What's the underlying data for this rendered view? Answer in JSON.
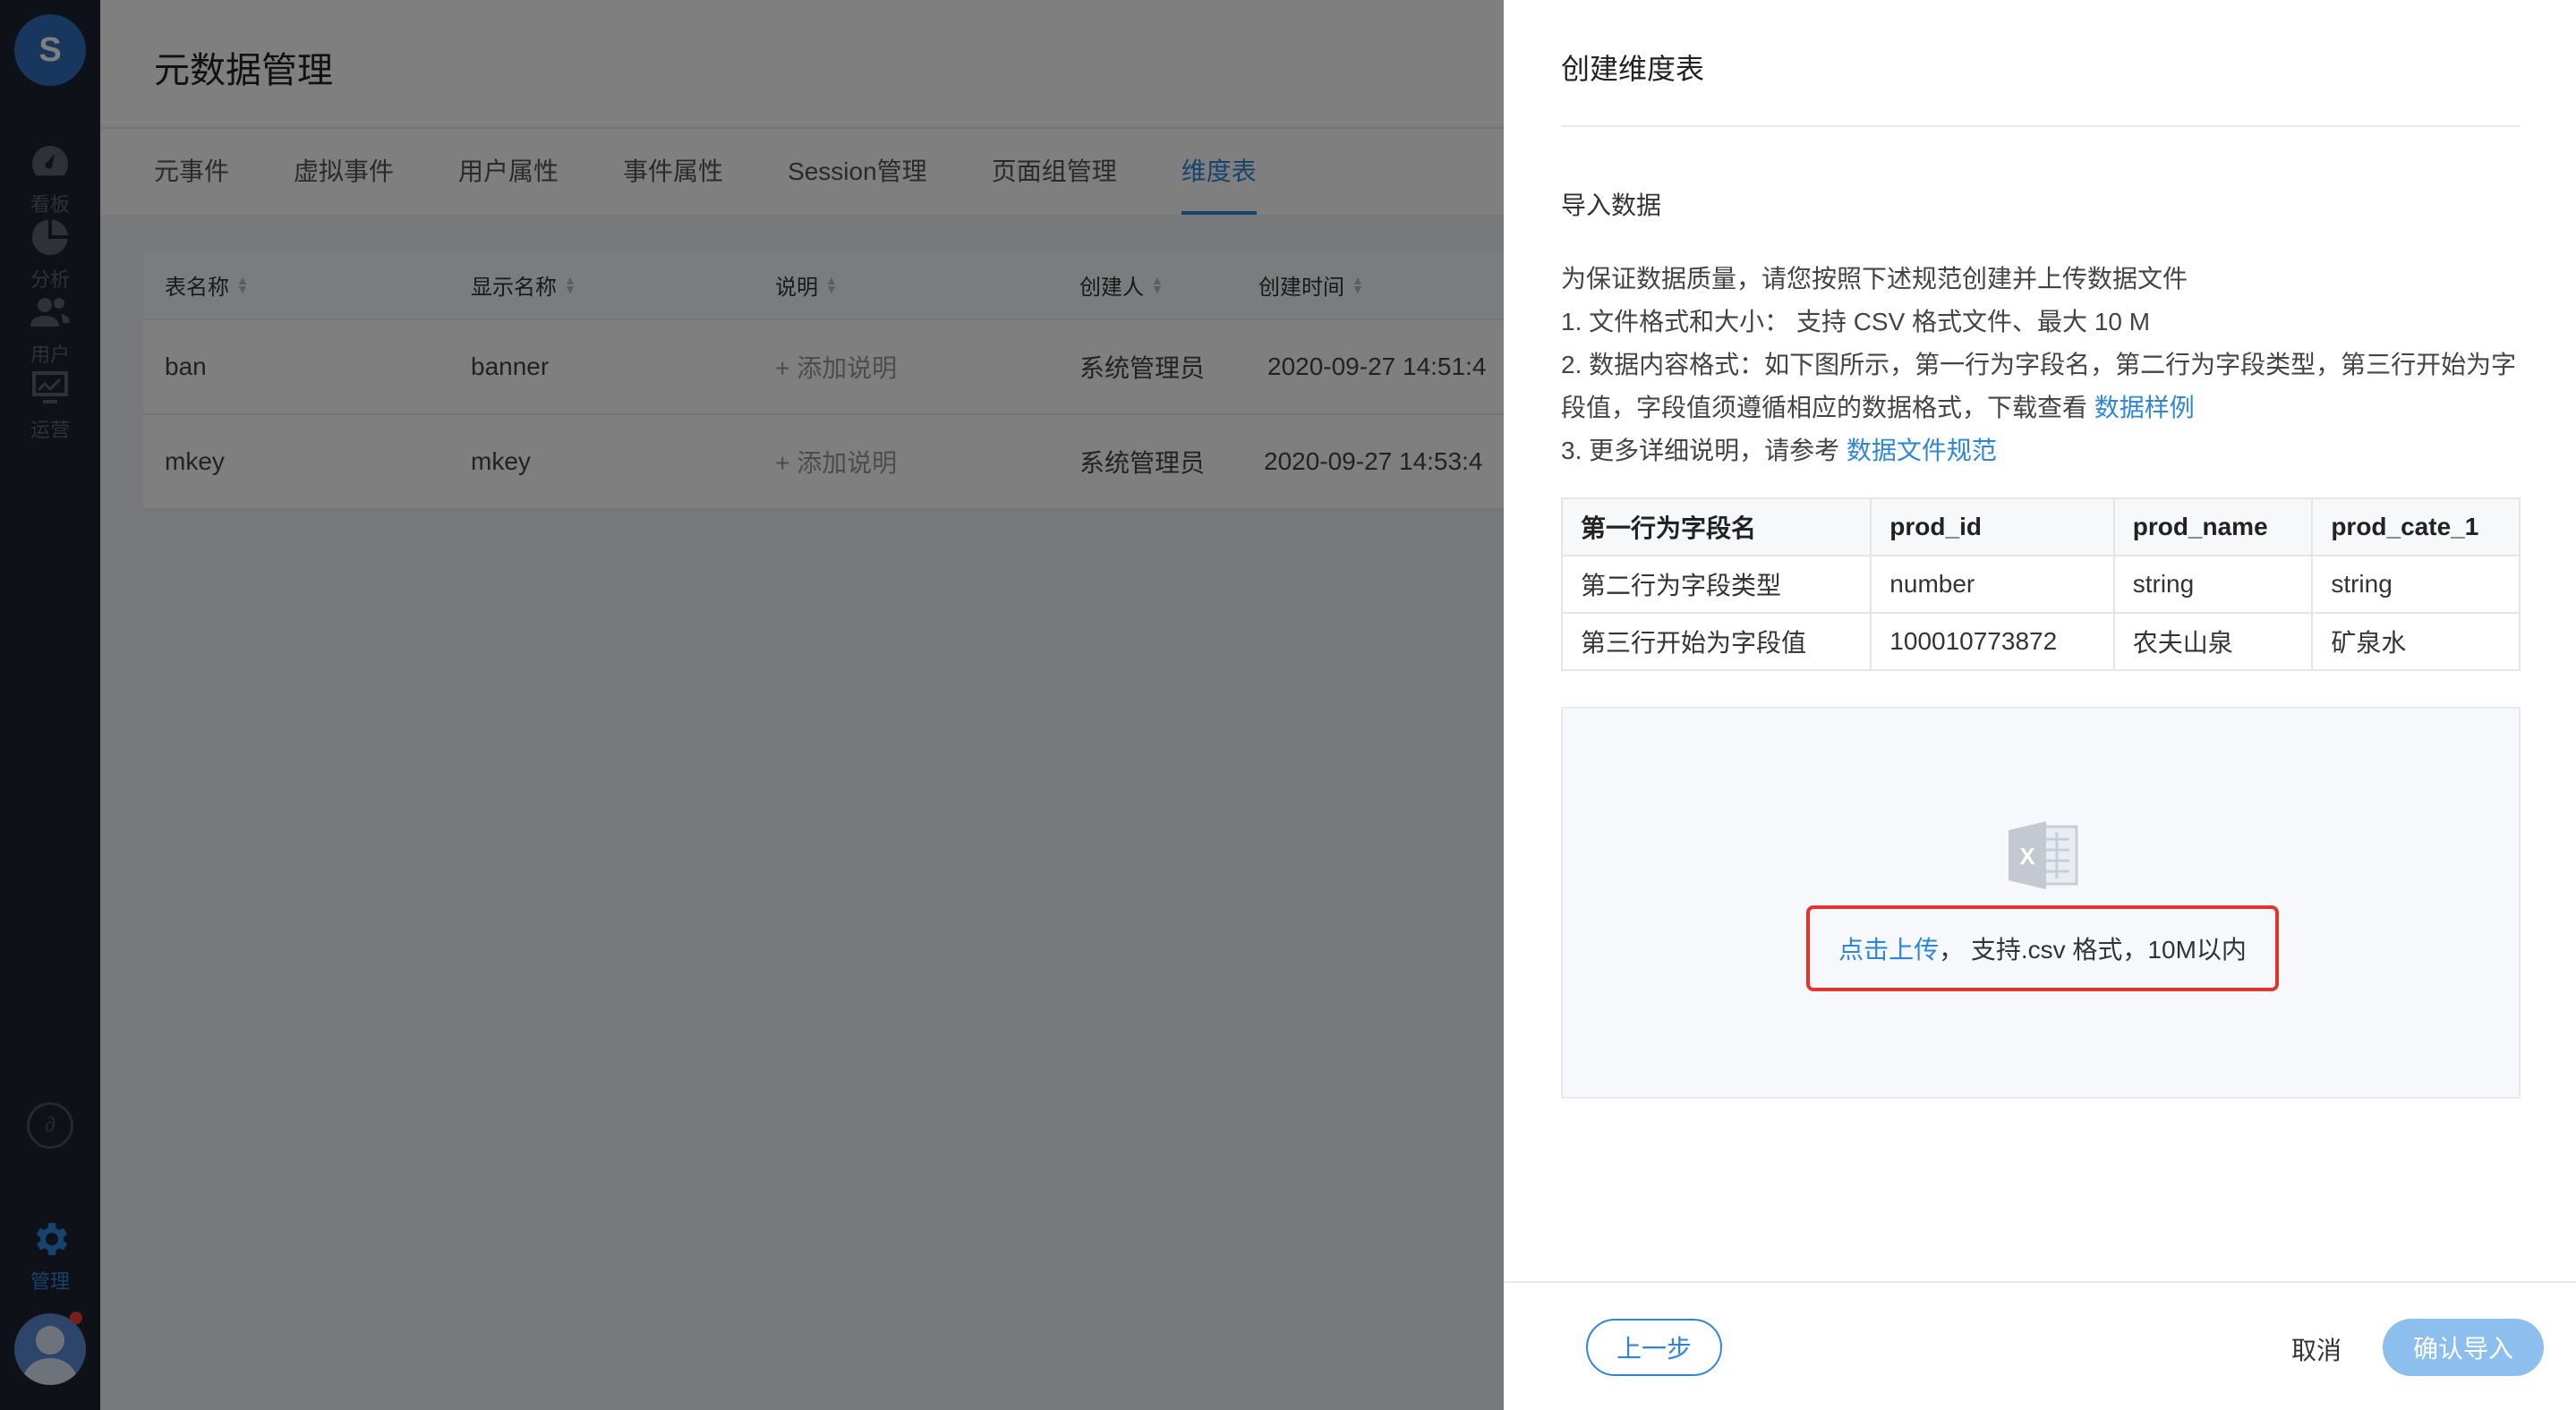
{
  "nav": {
    "logo": "S",
    "items": [
      {
        "label": "看板",
        "icon": "dashboard-icon"
      },
      {
        "label": "分析",
        "icon": "pie-chart-icon"
      },
      {
        "label": "用户",
        "icon": "users-icon"
      },
      {
        "label": "运营",
        "icon": "monitor-chart-icon"
      },
      {
        "label": "管理",
        "icon": "gear-icon"
      }
    ]
  },
  "page": {
    "title": "元数据管理",
    "tabs": [
      "元事件",
      "虚拟事件",
      "用户属性",
      "事件属性",
      "Session管理",
      "页面组管理",
      "维度表"
    ],
    "active_tab": "维度表"
  },
  "table": {
    "columns": [
      "表名称",
      "显示名称",
      "说明",
      "创建人",
      "创建时间"
    ],
    "rows": [
      {
        "name": "ban",
        "display": "banner",
        "desc": "+ 添加说明",
        "creator": "系统管理员",
        "created": "2020-09-27 14:51:4"
      },
      {
        "name": "mkey",
        "display": "mkey",
        "desc": "+ 添加说明",
        "creator": "系统管理员",
        "created": "2020-09-27 14:53:4"
      }
    ]
  },
  "drawer": {
    "title": "创建维度表",
    "section": "导入数据",
    "intro": "为保证数据质量，请您按照下述规范创建并上传数据文件",
    "rule1": "1. 文件格式和大小：  支持 CSV 格式文件、最大 10 M",
    "rule2a": "2. 数据内容格式：如下图所示，第一行为字段名，第二行为字段类型，第三行开始为字",
    "rule2b": "段值，字段值须遵循相应的数据格式，下载查看 ",
    "rule2_link": "数据样例",
    "rule3": "3. 更多详细说明，请参考 ",
    "rule3_link": "数据文件规范",
    "sample": {
      "header": [
        "第一行为字段名",
        "prod_id",
        "prod_name",
        "prod_cate_1"
      ],
      "row2": [
        "第二行为字段类型",
        "number",
        "string",
        "string"
      ],
      "row3": [
        "第三行开始为字段值",
        "100010773872",
        "农夫山泉",
        "矿泉水"
      ]
    },
    "upload_link": "点击上传",
    "upload_hint": "， 支持.csv 格式，10M以内",
    "btn_prev": "上一步",
    "btn_cancel": "取消",
    "btn_confirm": "确认导入"
  },
  "colors": {
    "accent": "#2f86d8",
    "highlight_border": "#e0342c",
    "nav_bg": "#1c2330"
  }
}
